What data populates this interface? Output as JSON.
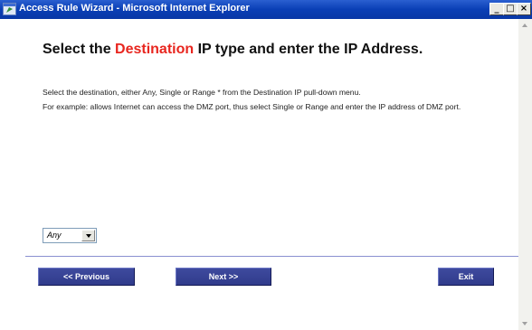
{
  "window": {
    "title": "Access Rule Wizard - Microsoft Internet Explorer",
    "min_glyph": "_",
    "max_glyph": "□",
    "close_glyph": "×"
  },
  "content": {
    "heading_pre": "Select the ",
    "heading_accent": "Destination",
    "heading_post": " IP type and enter the IP Address.",
    "para1": "Select the destination, either Any, Single or Range * from the Destination IP pull-down menu.",
    "para2": "For example: allows Internet can access the DMZ port, thus select Single or Range and enter the IP address of DMZ port.",
    "select_value": "Any"
  },
  "buttons": {
    "previous": "<< Previous",
    "next": "Next >>",
    "exit": "Exit"
  },
  "colors": {
    "titlebar": "#0a3fb5",
    "accent": "#e8261f",
    "button_bg": "#303b8c",
    "divider": "#8a8fd0"
  },
  "icons": {
    "app": "ie-icon"
  }
}
